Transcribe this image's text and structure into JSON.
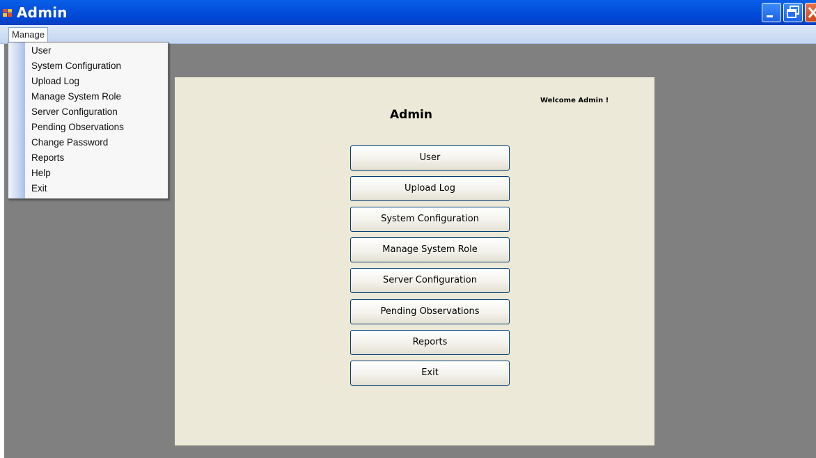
{
  "window": {
    "title": "Admin",
    "icon": "app-window-icon"
  },
  "menubar": {
    "manage_label": "Manage"
  },
  "dropdown": {
    "items": [
      "User",
      "System Configuration",
      "Upload Log",
      "Manage System Role",
      "Server Configuration",
      "Pending Observations",
      "Change Password",
      "Reports",
      "Help",
      "Exit"
    ]
  },
  "main": {
    "welcome": "Welcome Admin !",
    "heading": "Admin",
    "buttons": [
      "User",
      "Upload Log",
      "System Configuration",
      "Manage System Role",
      "Server Configuration",
      "Pending Observations",
      "Reports",
      "Exit"
    ]
  },
  "colors": {
    "titlebar": "#0047d4",
    "workspace": "#808080",
    "panel": "#ece9d8",
    "button_border": "#003c74"
  }
}
